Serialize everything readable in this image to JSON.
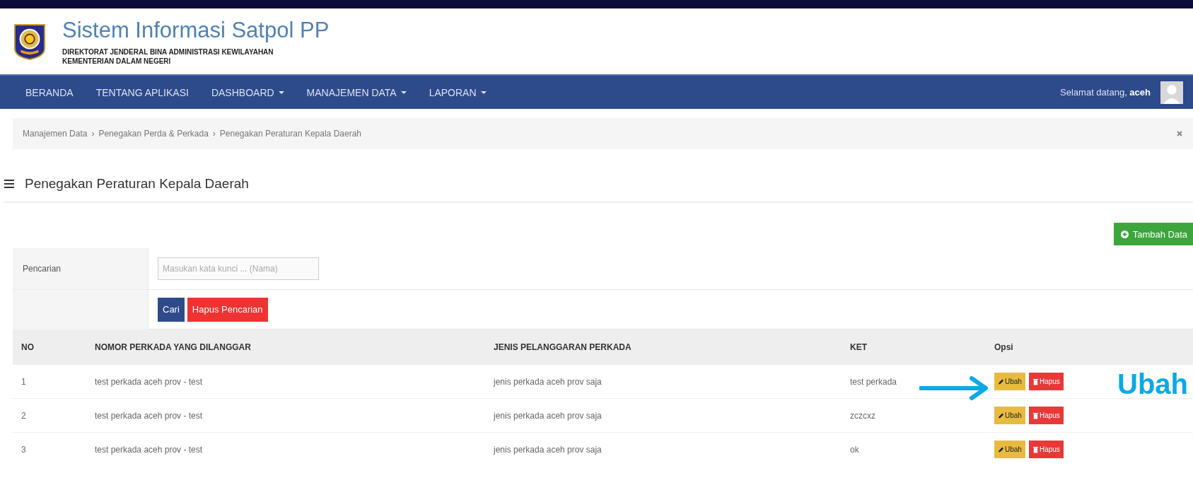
{
  "header": {
    "title": "Sistem Informasi Satpol PP",
    "subtitle_lines": [
      "DIREKTORAT JENDERAL BINA ADMINISTRASI KEWILAYAHAN",
      "KEMENTERIAN DALAM NEGERI"
    ]
  },
  "nav": {
    "items": [
      {
        "label": "BERANDA",
        "dropdown": false
      },
      {
        "label": "TENTANG APLIKASI",
        "dropdown": false
      },
      {
        "label": "DASHBOARD",
        "dropdown": true
      },
      {
        "label": "MANAJEMEN DATA",
        "dropdown": true
      },
      {
        "label": "LAPORAN",
        "dropdown": true
      }
    ],
    "greeting": "Selamat datang, **aceh**"
  },
  "breadcrumb": {
    "separator": "›",
    "items": [
      "Manajemen Data",
      "Penegakan Perda & Perkada",
      "Penegakan Peraturan Kepala Daerah"
    ]
  },
  "page_title": "Penegakan Peraturan Kepala Daerah",
  "add_button": "Tambah Data",
  "search": {
    "label": "Pencarian",
    "placeholder": "Masukan kata kunci ... (Nama)",
    "buttons": [
      {
        "label": "Cari",
        "kind": "primary"
      },
      {
        "label": "Hapus Pencarian",
        "kind": "danger"
      }
    ]
  },
  "table": {
    "columns": [
      "NO",
      "NOMOR PERKADA YANG DILANGGAR",
      "JENIS PELANGGARAN PERKADA",
      "KET",
      "Opsi"
    ],
    "rows": [
      {
        "cells": [
          "1",
          "test perkada aceh prov - test",
          "jenis perkada aceh prov saja",
          "test perkada"
        ],
        "actions": [
          "Ubah",
          "Hapus"
        ]
      },
      {
        "cells": [
          "2",
          "test perkada aceh prov - test",
          "jenis perkada aceh prov saja",
          "zczcxz"
        ],
        "actions": [
          "Ubah",
          "Hapus"
        ]
      },
      {
        "cells": [
          "3",
          "test perkada aceh prov - test",
          "jenis perkada aceh prov saja",
          "ok"
        ],
        "actions": [
          "Ubah",
          "Hapus"
        ]
      }
    ]
  },
  "annotation": {
    "text": "Ubah"
  }
}
